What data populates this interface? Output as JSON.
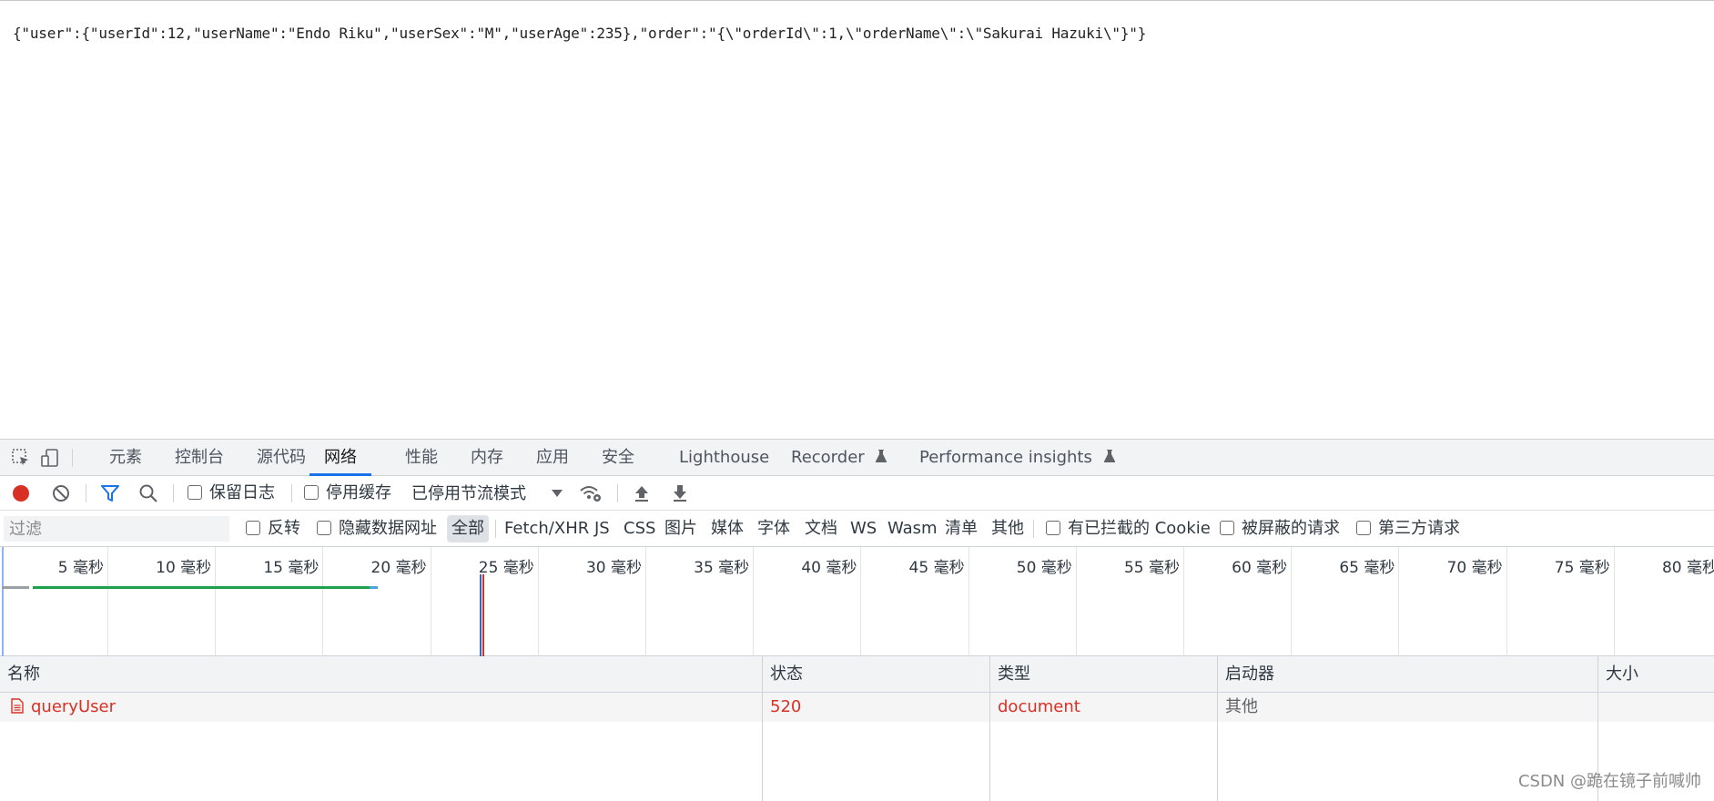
{
  "page": {
    "json_text": "{\"user\":{\"userId\":12,\"userName\":\"Endo Riku\",\"userSex\":\"M\",\"userAge\":235},\"order\":\"{\\\"orderId\\\":1,\\\"orderName\\\":\\\"Sakurai Hazuki\\\"}\"}"
  },
  "devtools": {
    "tabs": [
      {
        "label": "元素",
        "active": false
      },
      {
        "label": "控制台",
        "active": false
      },
      {
        "label": "源代码",
        "active": false
      },
      {
        "label": "网络",
        "active": true
      },
      {
        "label": "性能",
        "active": false
      },
      {
        "label": "内存",
        "active": false
      },
      {
        "label": "应用",
        "active": false
      },
      {
        "label": "安全",
        "active": false
      },
      {
        "label": "Lighthouse",
        "active": false
      },
      {
        "label": "Recorder",
        "active": false
      },
      {
        "label": "Performance insights",
        "active": false
      }
    ],
    "toolbar": {
      "preserve_log": "保留日志",
      "disable_cache": "停用缓存",
      "throttling": "已停用节流模式"
    },
    "filter": {
      "placeholder": "过滤",
      "invert": "反转",
      "hide_data_urls": "隐藏数据网址",
      "types": [
        "全部",
        "Fetch/XHR",
        "JS",
        "CSS",
        "图片",
        "媒体",
        "字体",
        "文档",
        "WS",
        "Wasm",
        "清单",
        "其他"
      ],
      "blocked_cookies": "有已拦截的 Cookie",
      "blocked_requests": "被屏蔽的请求",
      "third_party": "第三方请求"
    },
    "overview": {
      "ticks": [
        "5 毫秒",
        "10 毫秒",
        "15 毫秒",
        "20 毫秒",
        "25 毫秒",
        "30 毫秒",
        "35 毫秒",
        "40 毫秒",
        "45 毫秒",
        "50 毫秒",
        "55 毫秒",
        "60 毫秒",
        "65 毫秒",
        "70 毫秒",
        "75 毫秒",
        "80 毫秒"
      ]
    },
    "table": {
      "columns": [
        "名称",
        "状态",
        "类型",
        "启动器",
        "大小"
      ],
      "rows": [
        {
          "name": "queryUser",
          "status": "520",
          "type": "document",
          "initiator": "其他",
          "size": ""
        }
      ]
    }
  },
  "watermark": "CSDN @跪在镜子前喊帅",
  "colors": {
    "accent": "#1a73e8",
    "record": "#d93025",
    "error_text": "#d93025",
    "waterfall_bar": "#1aa34a"
  }
}
